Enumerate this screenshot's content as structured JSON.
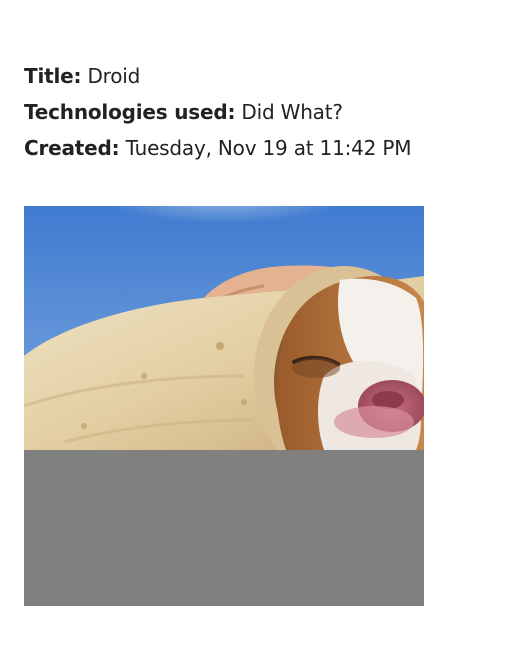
{
  "details": {
    "title_label": "Title:",
    "title_value": "Droid",
    "tech_label": "Technologies used:",
    "tech_value": "Did What?",
    "created_label": "Created:",
    "created_value": "Tuesday, Nov 19 at 11:42 PM"
  },
  "image": {
    "subject": "puppy wrapped in tortilla",
    "loaded_fraction": 0.61,
    "placeholder_color": "#808080",
    "sky_color": "#4a83d0"
  }
}
